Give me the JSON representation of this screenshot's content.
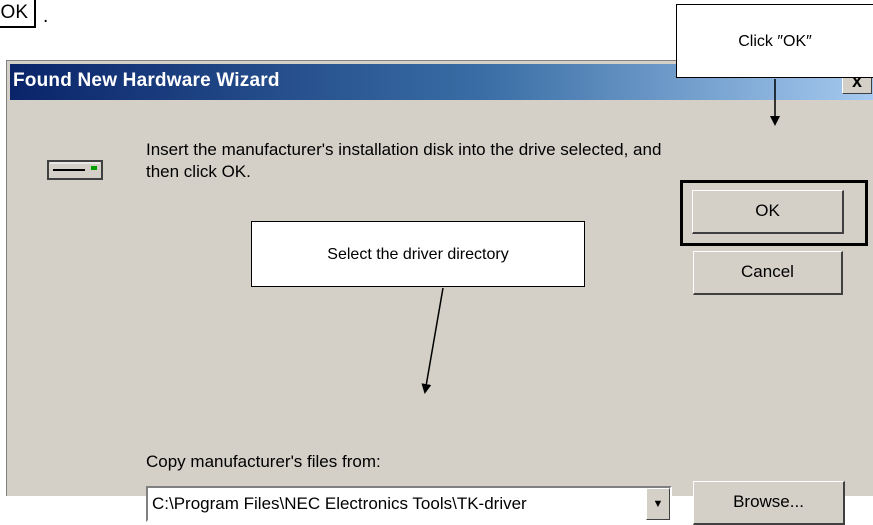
{
  "fragment": {
    "box_text": "OK",
    "trailing": "."
  },
  "window": {
    "title": "Found New Hardware Wizard",
    "close_label": "x",
    "message": "Insert the manufacturer's installation disk into the drive selected, and then click OK.",
    "ok_label": "OK",
    "cancel_label": "Cancel",
    "copy_label": "Copy manufacturer's files from:",
    "path_value": "C:\\Program Files\\NEC Electronics Tools\\TK-driver",
    "dropdown_icon": "▼",
    "browse_label": "Browse..."
  },
  "callouts": {
    "ok": "Click ″OK″",
    "directory": "Select the driver directory"
  }
}
